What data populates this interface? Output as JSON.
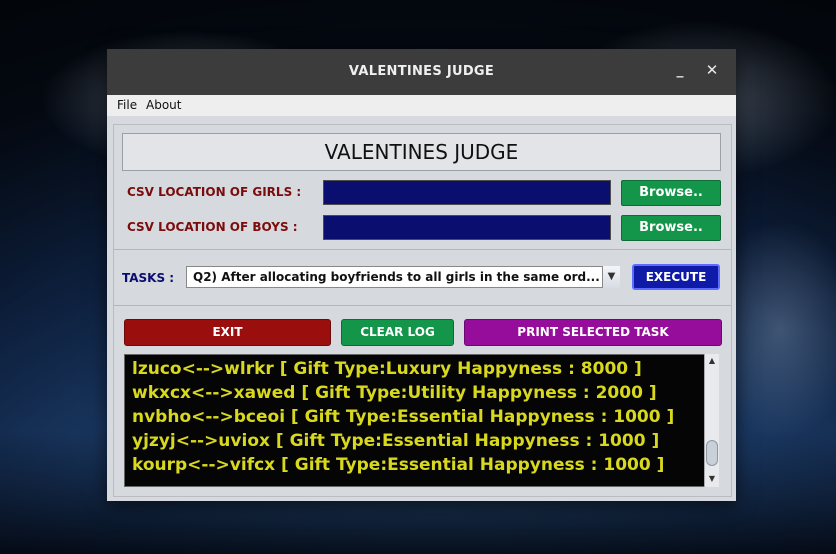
{
  "window": {
    "title": "VALENTINES JUDGE",
    "minimize_glyph": "_",
    "close_glyph": "✕"
  },
  "menu": {
    "items": [
      {
        "label": "File"
      },
      {
        "label": "About"
      }
    ]
  },
  "heading": "VALENTINES JUDGE",
  "girls": {
    "label": "CSV LOCATION OF GIRLS :",
    "value": "",
    "browse_label": "Browse.."
  },
  "boys": {
    "label": "CSV LOCATION OF BOYS  :",
    "value": "",
    "browse_label": "Browse.."
  },
  "tasks": {
    "label": "TASKS :",
    "selected": "Q2) After allocating boyfriends to all girls in the same ord...",
    "execute_label": "EXECUTE"
  },
  "actions": {
    "exit_label": "EXIT",
    "clear_label": "CLEAR LOG",
    "print_label": "PRINT SELECTED TASK"
  },
  "log": {
    "lines": [
      "lzuco<-->wlrkr [ Gift Type:Luxury Happyness : 8000 ]",
      "wkxcx<-->xawed [ Gift Type:Utility Happyness : 2000 ]",
      "nvbho<-->bceoi [ Gift Type:Essential Happyness : 1000 ]",
      "yjzyj<-->uviox [ Gift Type:Essential Happyness : 1000 ]",
      "kourp<-->vifcx [ Gift Type:Essential Happyness : 1000 ]"
    ]
  },
  "colors": {
    "field_bg": "#0a0e6e",
    "browse_green": "#13954a",
    "exit_red": "#9b0e0e",
    "print_purple": "#960d9c",
    "execute_blue": "#0f1aa8",
    "log_text": "#d8d81e"
  }
}
